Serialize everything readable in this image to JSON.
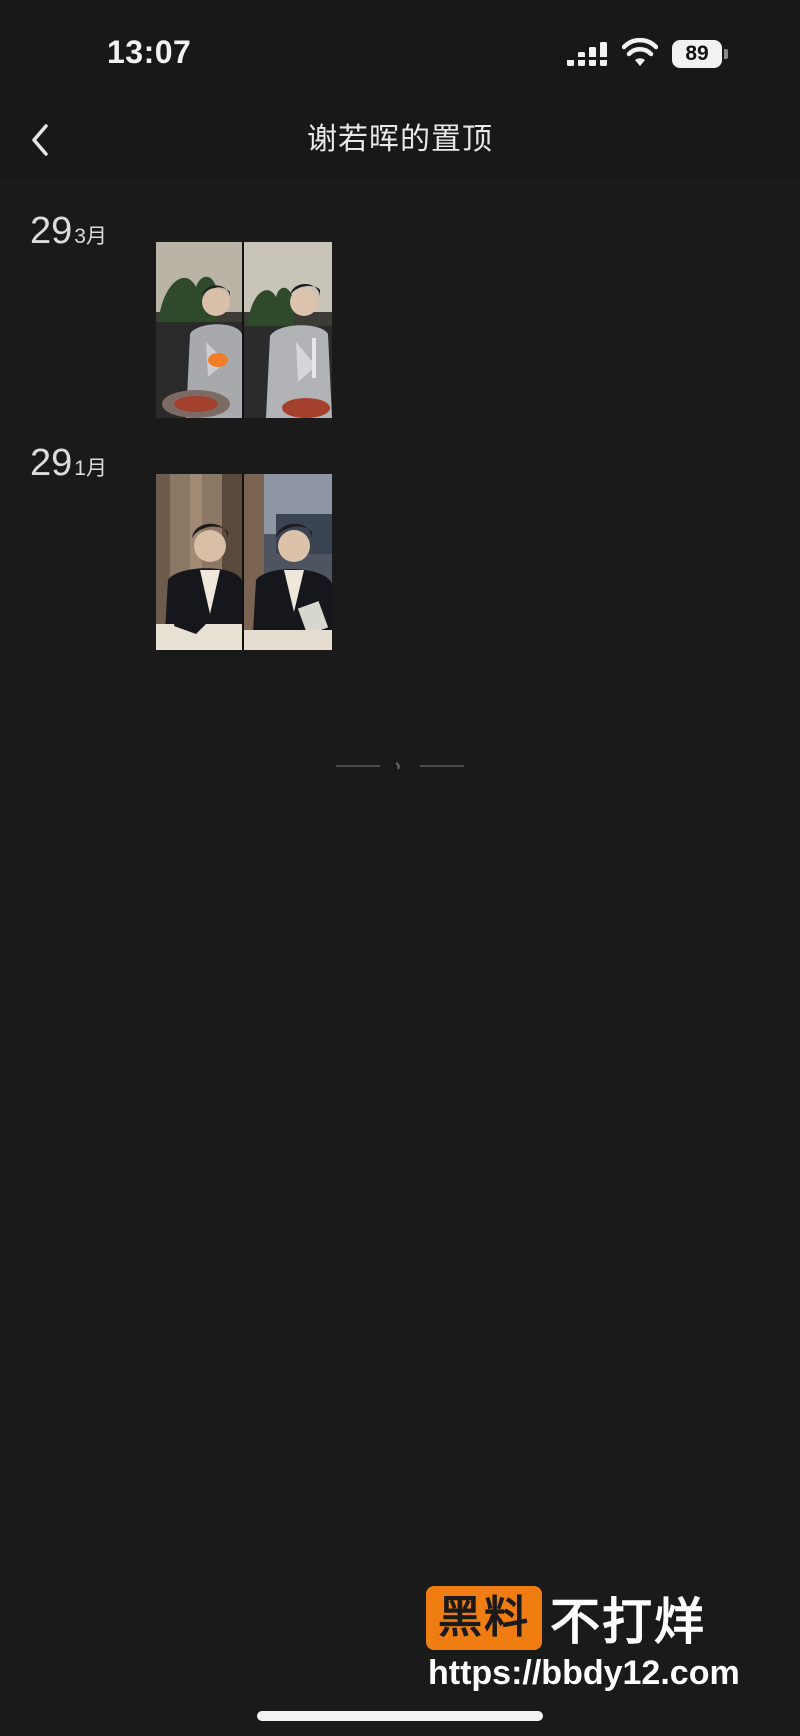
{
  "status_bar": {
    "time": "13:07",
    "battery": "89",
    "icons": [
      "signal-icon",
      "wifi-icon",
      "battery-icon"
    ]
  },
  "nav": {
    "back_icon": "chevron-left-icon",
    "title": "谢若晖的置顶"
  },
  "entries": [
    {
      "day": "29",
      "month": "3月",
      "photos": [
        "photo-pair-dinner"
      ]
    },
    {
      "day": "29",
      "month": "1月",
      "photos": [
        "photo-pair-desk"
      ]
    }
  ],
  "watermark": {
    "brand_highlight": "黑料",
    "brand_rest": "不打烊",
    "url": "https://bbdy12.com"
  },
  "colors": {
    "background": "#1a1a1a",
    "header": "#181818",
    "text": "#e6e6e6",
    "watermark_orange": "#f07d12"
  }
}
